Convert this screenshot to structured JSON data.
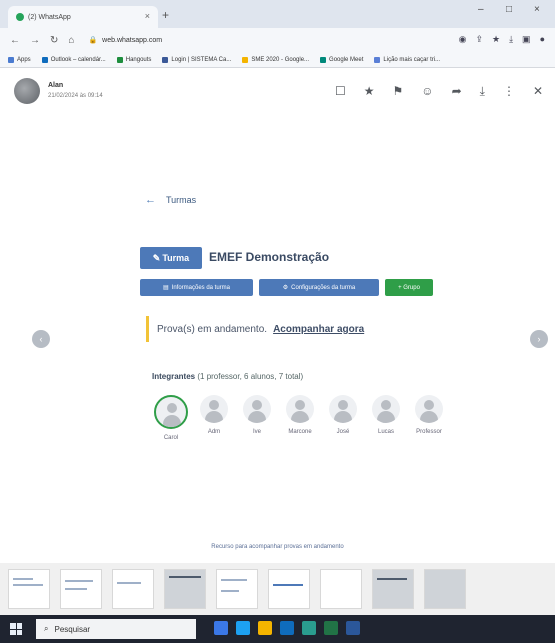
{
  "browser": {
    "tab_title": "(2) WhatsApp",
    "tab_close": "×",
    "new_tab": "+",
    "url": "web.whatsapp.com",
    "window_min": "–",
    "window_close": "×",
    "bookmarks": [
      {
        "label": "Apps",
        "color": "#4a7bd0"
      },
      {
        "label": "Outlook – calendár...",
        "color": "#0f6cbd"
      },
      {
        "label": "Hangouts",
        "color": "#1e8e3e"
      },
      {
        "label": "Login | SISTEMA Ca...",
        "color": "#3b5998"
      },
      {
        "label": "SME 2020 - Google...",
        "color": "#f4b400"
      },
      {
        "label": "Google Meet",
        "color": "#00897b"
      },
      {
        "label": "Lição mais caçar tri...",
        "color": "#5a7fd6"
      }
    ]
  },
  "viewer": {
    "sender": "Alan",
    "timestamp": "21/02/2024 às 09:14"
  },
  "page": {
    "back_label": "Turmas",
    "turma_badge": "Turma",
    "school_name": "EMEF Demonstração",
    "buttons": {
      "info": "Informações da turma",
      "settings": "Configurações da turma",
      "new": "+ Grupo"
    },
    "alert_text": "Prova(s) em andamento.",
    "alert_link": "Acompanhar agora",
    "members_title": "Integrantes",
    "members_subtitle": "(1 professor, 6 alunos, 7 total)",
    "members": [
      "Carol",
      "Adm",
      "Ive",
      "Marcone",
      "José",
      "Lucas",
      "Professor"
    ],
    "footnote": "Recurso para acompanhar provas em andamento"
  },
  "taskbar": {
    "search_placeholder": "Pesquisar"
  },
  "colors": {
    "primary": "#4d79b8",
    "success": "#2f9e48",
    "warning": "#f2c337"
  }
}
